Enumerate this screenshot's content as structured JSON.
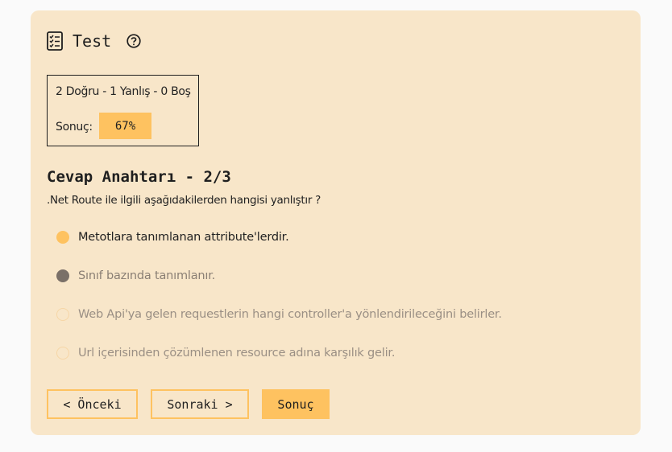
{
  "header": {
    "title": "Test",
    "icon": "checklist-icon",
    "help_icon": "help-circle-icon"
  },
  "summary": {
    "counts": "2 Doğru - 1 Yanlış - 0 Boş",
    "score_label": "Sonuç:",
    "score_value": "67%"
  },
  "section": {
    "title": "Cevap Anahtarı - 2/3",
    "question": ".Net Route ile ilgili aşağıdakilerden hangisi yanlıştır ?"
  },
  "options": [
    {
      "label": "Metotlara tanımlanan attribute'lerdir.",
      "state": "correct"
    },
    {
      "label": "Sınıf bazında tanımlanır.",
      "state": "selected-wrong"
    },
    {
      "label": "Web Api'ya gelen requestlerin hangi controller'a yönlendirileceğini belirler.",
      "state": "none"
    },
    {
      "label": "Url içerisinden çözümlenen resource adına karşılık gelir.",
      "state": "none"
    }
  ],
  "buttons": {
    "prev": "< Önceki",
    "next": "Sonraki >",
    "result": "Sonuç"
  },
  "colors": {
    "card_bg": "#f8e6c9",
    "accent": "#fec260",
    "wrong_dot": "#7a7068"
  }
}
